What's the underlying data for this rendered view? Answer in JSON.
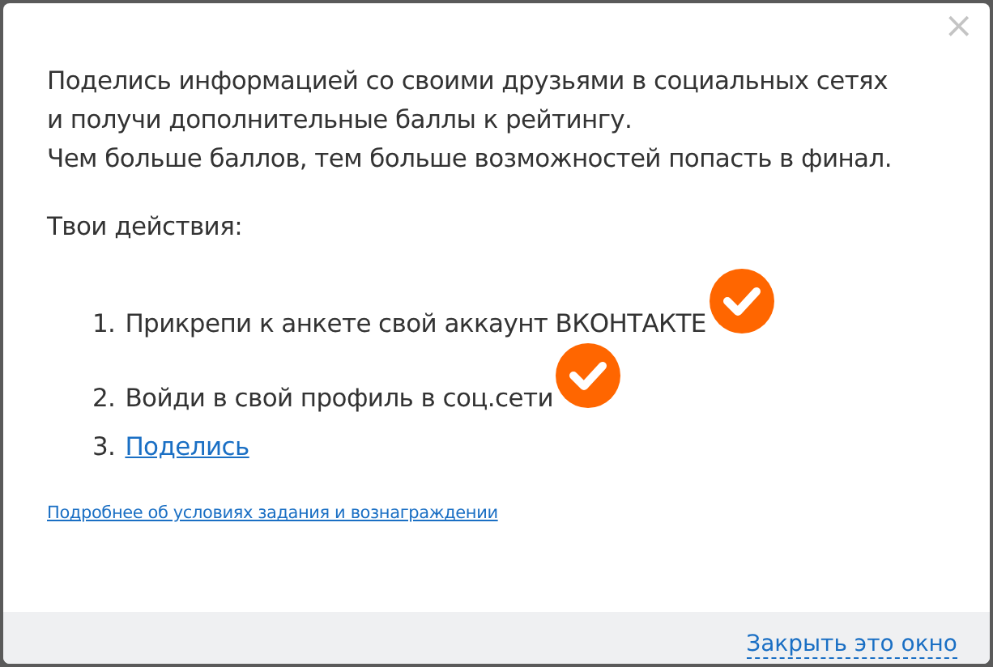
{
  "dialog": {
    "close_icon": "×",
    "intro": [
      "Поделись информацией со своими друзьями в социальных сетях",
      "и получи дополнительные баллы к рейтингу.",
      "Чем больше баллов, тем больше возможностей попасть в финал."
    ],
    "actions_title": "Твои действия:",
    "steps": [
      {
        "number": "1.",
        "kind": "text",
        "label": "Прикрепи к анкете свой аккаунт ВКОНТАКТЕ",
        "done": true
      },
      {
        "number": "2.",
        "kind": "text",
        "label": "Войди в свой профиль в соц.сети",
        "done": true
      },
      {
        "number": "3.",
        "kind": "link",
        "label": "Поделись",
        "done": false
      }
    ],
    "details_link": "Подробнее об условиях задания и вознаграждении",
    "footer": {
      "close_link": "Закрыть это окно"
    }
  }
}
